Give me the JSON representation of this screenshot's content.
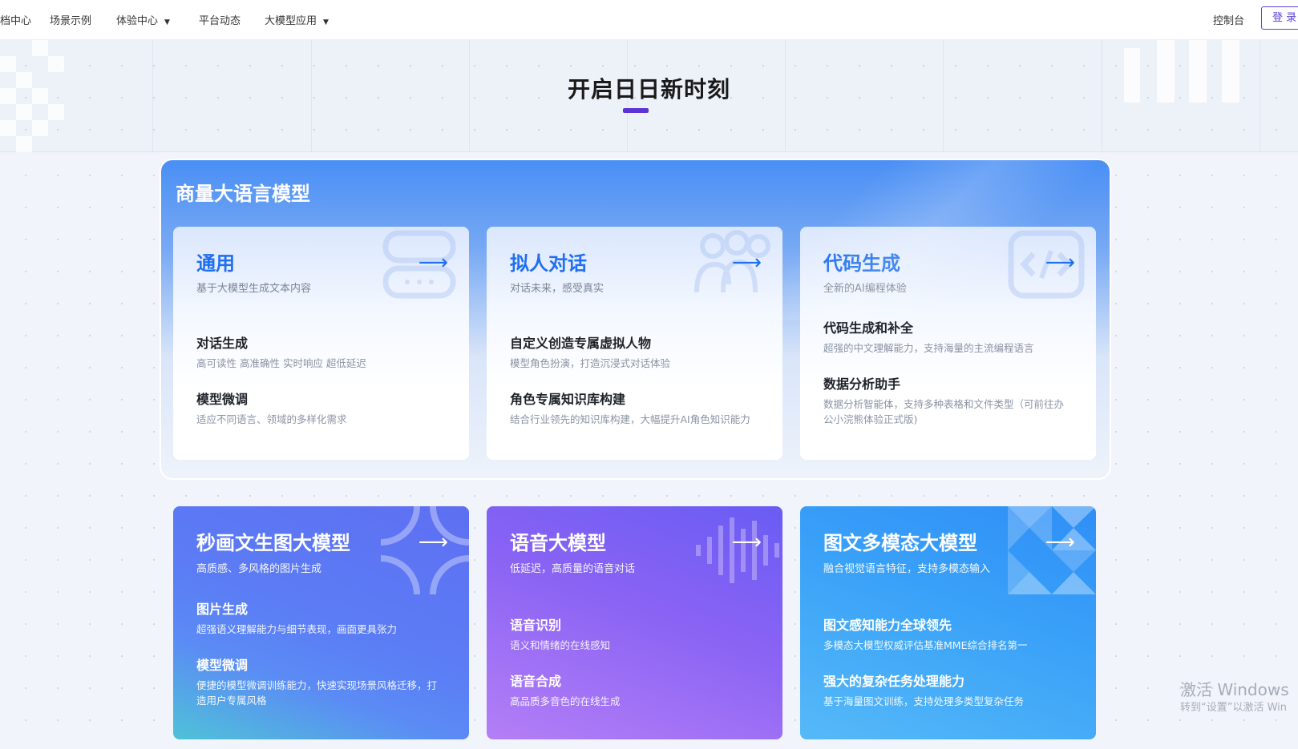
{
  "nav": {
    "items": [
      {
        "label": "档中心",
        "caret": false
      },
      {
        "label": "场景示例",
        "caret": false
      },
      {
        "label": "体验中心",
        "caret": true
      },
      {
        "label": "平台动态",
        "caret": false
      },
      {
        "label": "大模型应用",
        "caret": true
      }
    ],
    "console": "控制台",
    "login": "登 录"
  },
  "hero": {
    "title": "开启日日新时刻"
  },
  "commercial": {
    "title": "商量大语言模型",
    "cards": [
      {
        "title": "通用",
        "subtitle": "基于大模型生成文本内容",
        "icon": "chat-bubble-icon",
        "features": [
          {
            "name": "对话生成",
            "desc": "高可读性 高准确性 实时响应 超低延迟"
          },
          {
            "name": "模型微调",
            "desc": "适应不同语言、领域的多样化需求"
          }
        ]
      },
      {
        "title": "拟人对话",
        "subtitle": "对话未来，感受真实",
        "icon": "people-icon",
        "features": [
          {
            "name": "自定义创造专属虚拟人物",
            "desc": "模型角色扮演，打造沉浸式对话体验"
          },
          {
            "name": "角色专属知识库构建",
            "desc": "结合行业领先的知识库构建，大幅提升AI角色知识能力"
          }
        ]
      },
      {
        "title": "代码生成",
        "subtitle": "全新的AI编程体验",
        "icon": "code-icon",
        "features": [
          {
            "name": "代码生成和补全",
            "desc": "超强的中文理解能力，支持海量的主流编程语言"
          },
          {
            "name": "数据分析助手",
            "desc": "数据分析智能体，支持多种表格和文件类型（可前往办公小浣熊体验正式版)"
          }
        ]
      }
    ]
  },
  "models": [
    {
      "title": "秒画文生图大模型",
      "subtitle": "高质感、多风格的图片生成",
      "icon": "image-pattern-icon",
      "features": [
        {
          "name": "图片生成",
          "desc": "超强语义理解能力与细节表现，画面更具张力"
        },
        {
          "name": "模型微调",
          "desc": "便捷的模型微调训练能力，快速实现场景风格迁移，打造用户专属风格"
        }
      ]
    },
    {
      "title": "语音大模型",
      "subtitle": "低延迟，高质量的语音对话",
      "icon": "waveform-icon",
      "features": [
        {
          "name": "语音识别",
          "desc": "语义和情绪的在线感知"
        },
        {
          "name": "语音合成",
          "desc": "高品质多音色的在线生成"
        }
      ]
    },
    {
      "title": "图文多模态大模型",
      "subtitle": "融合视觉语言特征，支持多模态输入",
      "icon": "triangles-icon",
      "features": [
        {
          "name": "图文感知能力全球领先",
          "desc": "多模态大模型权威评估基准MME综合排名第一"
        },
        {
          "name": "强大的复杂任务处理能力",
          "desc": "基于海量图文训练，支持处理多类型复杂任务"
        }
      ]
    }
  ],
  "watermark": {
    "line1": "激活 Windows",
    "line2": "转到“设置”以激活 Win"
  },
  "colors": {
    "brand": "#5b34d6",
    "link_blue": "#1f6ff1"
  }
}
